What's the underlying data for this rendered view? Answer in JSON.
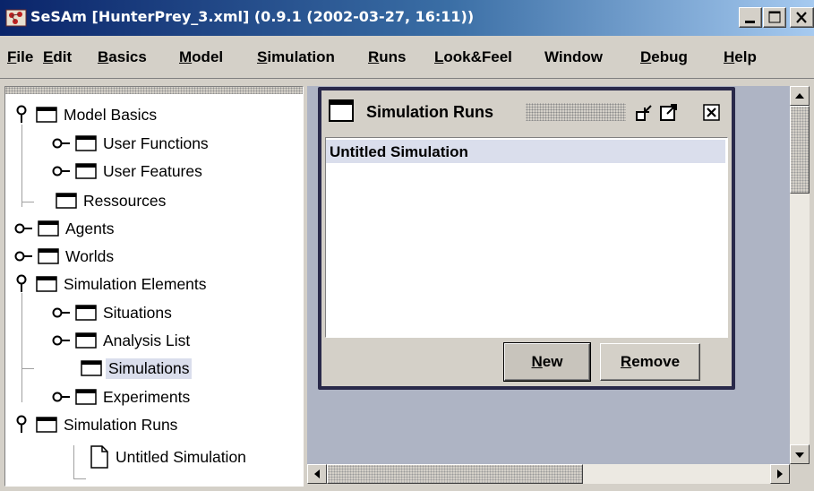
{
  "window": {
    "title": "SeSAm [HunterPrey_3.xml] (0.9.1 (2002-03-27, 16:11))",
    "icons": [
      "app-icon",
      "minimize-icon",
      "maximize-icon",
      "close-icon"
    ]
  },
  "menu": {
    "items": [
      {
        "mnemonic": "F",
        "rest": "ile"
      },
      {
        "mnemonic": "E",
        "rest": "dit"
      },
      {
        "mnemonic": "B",
        "rest": "asics"
      },
      {
        "mnemonic": "M",
        "rest": "odel"
      },
      {
        "mnemonic": "S",
        "rest": "imulation"
      },
      {
        "mnemonic": "R",
        "rest": "uns"
      },
      {
        "mnemonic": "L",
        "rest": "ook&Feel"
      },
      {
        "mnemonic": "",
        "rest": "Window"
      },
      {
        "mnemonic": "D",
        "rest": "ebug"
      },
      {
        "mnemonic": "H",
        "rest": "elp"
      }
    ]
  },
  "tree": {
    "items": [
      {
        "label": "Model Basics",
        "expanded": true,
        "icon": "folder-icon"
      },
      {
        "label": "User Functions",
        "expanded": false,
        "icon": "folder-icon"
      },
      {
        "label": "User Features",
        "expanded": false,
        "icon": "folder-icon"
      },
      {
        "label": "Ressources",
        "leaf": true,
        "icon": "folder-icon"
      },
      {
        "label": "Agents",
        "expanded": false,
        "icon": "folder-icon"
      },
      {
        "label": "Worlds",
        "expanded": false,
        "icon": "folder-icon"
      },
      {
        "label": "Simulation Elements",
        "expanded": true,
        "icon": "folder-icon"
      },
      {
        "label": "Situations",
        "expanded": false,
        "icon": "folder-icon"
      },
      {
        "label": "Analysis List",
        "expanded": false,
        "icon": "folder-icon"
      },
      {
        "label": "Simulations",
        "leaf": true,
        "selected": true,
        "icon": "folder-icon"
      },
      {
        "label": "Experiments",
        "expanded": false,
        "icon": "folder-icon"
      },
      {
        "label": "Simulation Runs",
        "expanded": true,
        "icon": "folder-icon"
      },
      {
        "label": "Untitled Simulation",
        "leaf": true,
        "icon": "document-icon"
      }
    ]
  },
  "internal_frame": {
    "title": "Simulation Runs",
    "list_items": [
      "Untitled Simulation"
    ],
    "buttons": {
      "new": {
        "mnemonic": "N",
        "rest": "ew"
      },
      "remove": {
        "mnemonic": "R",
        "rest": "emove"
      }
    }
  },
  "colors": {
    "titlebar_start": "#0a246a",
    "titlebar_end": "#a6caf0",
    "desktop": "#aeb4c4",
    "frame_border": "#29294a",
    "selection": "#dadeec"
  }
}
